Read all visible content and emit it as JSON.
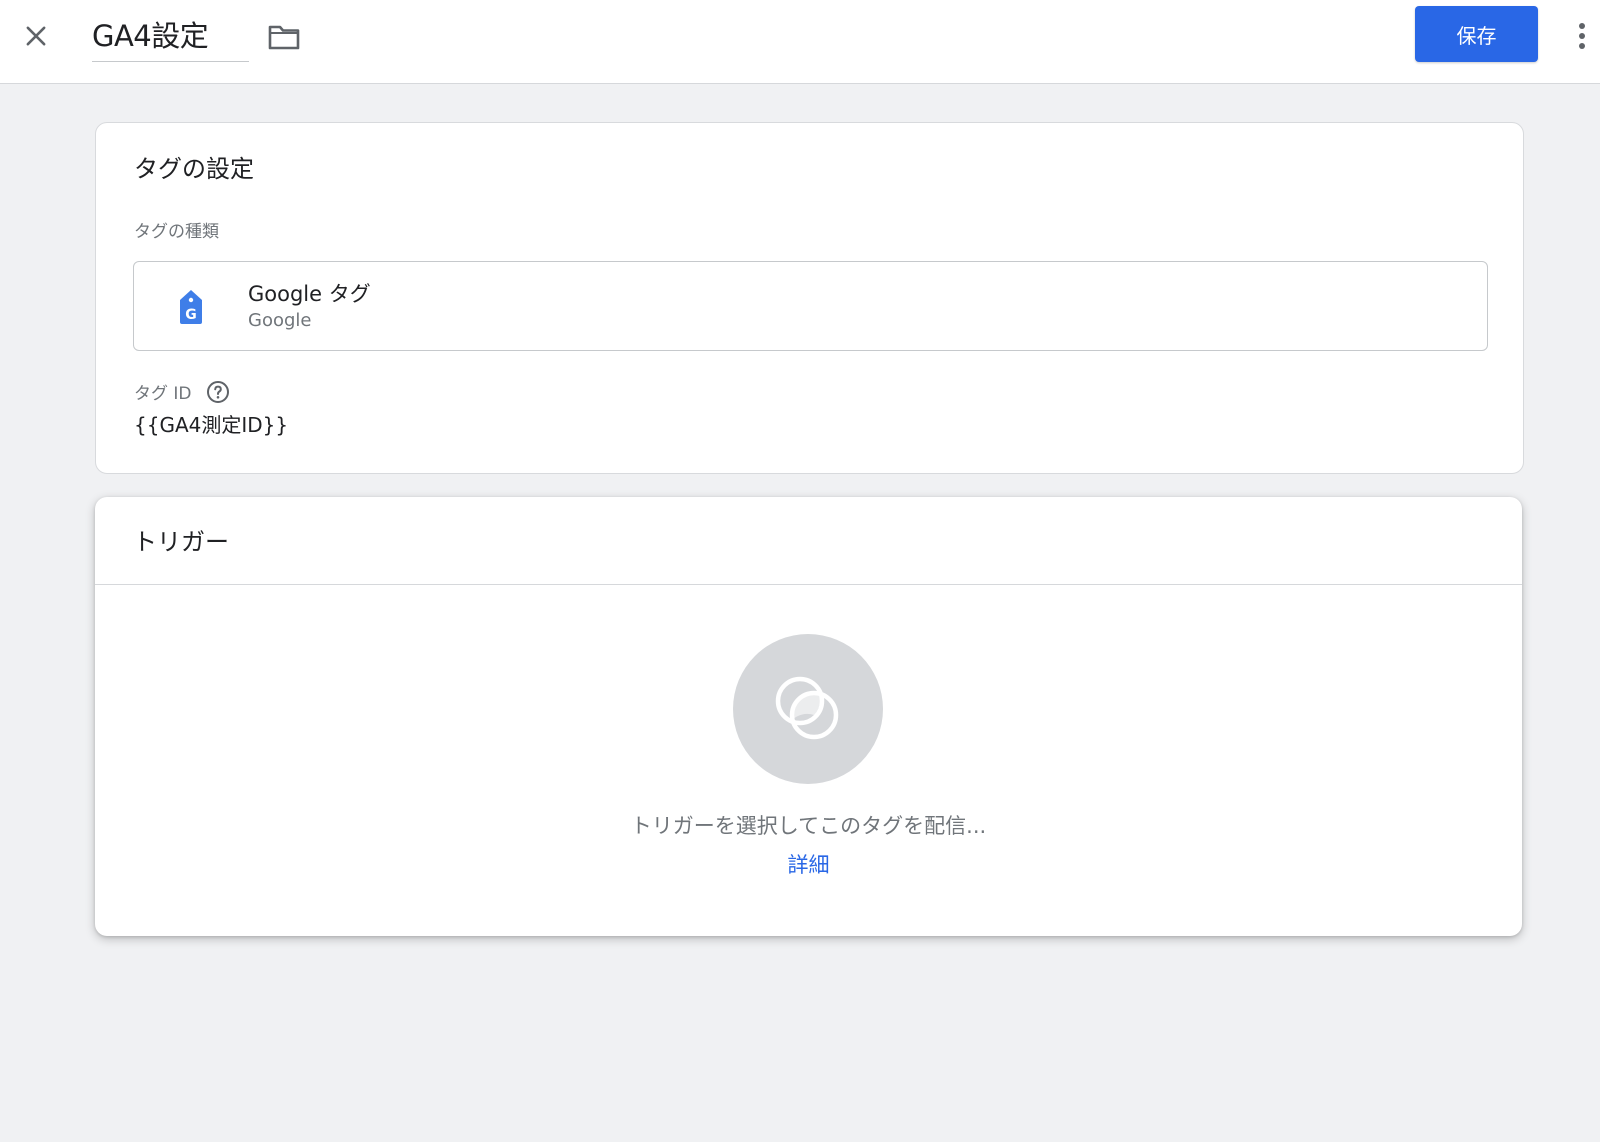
{
  "header": {
    "title": "GA4設定",
    "save_label": "保存",
    "icons": {
      "close": "close-icon",
      "folder": "folder-icon",
      "more": "more-vert-icon"
    }
  },
  "tag_config": {
    "title": "タグの設定",
    "type_label": "タグの種類",
    "type_name": "Google タグ",
    "type_vendor": "Google",
    "tag_icon": "google-tag-icon",
    "tag_icon_letter": "G",
    "tag_id_label": "タグ ID",
    "tag_id_value": "{{GA4測定ID}}"
  },
  "trigger": {
    "title": "トリガー",
    "empty_message": "トリガーを選択してこのタグを配信...",
    "learn_more": "詳細",
    "icon": "trigger-icon"
  },
  "colors": {
    "accent": "#2967e6",
    "background": "#f0f1f3",
    "card": "#ffffff",
    "muted_text": "#70757a",
    "trigger_circle": "#d5d7da"
  }
}
